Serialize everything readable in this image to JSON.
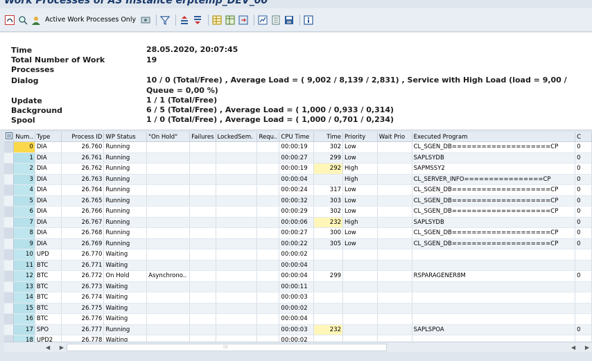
{
  "window": {
    "title": "Work Processes of AS Instance erptemp_DEV_00"
  },
  "toolbar": {
    "active_only_label": "Active Work Processes Only"
  },
  "info": [
    {
      "label": "Time",
      "value": "28.05.2020, 20:07:45"
    },
    {
      "label": "Total Number of Work Processes",
      "value": "19"
    },
    {
      "label": "Dialog",
      "value": "10 / 0 (Total/Free) , Average Load = ( 9,002 / 8,139 / 2,831) , Service with High Load (load = 9,00 / Queue = 0,00 %)"
    },
    {
      "label": "Update",
      "value": "1 / 1 (Total/Free)"
    },
    {
      "label": "Background",
      "value": "6 / 5 (Total/Free) , Average Load = ( 1,000 / 0,933 / 0,314)"
    },
    {
      "label": "Spool",
      "value": "1 / 0 (Total/Free) , Average Load = ( 1,000 / 0,701 / 0,234)"
    }
  ],
  "table": {
    "columns": [
      "Num..",
      "Type",
      "Process ID",
      "WP Status",
      "\"On Hold\"",
      "Failures",
      "LockedSem.",
      "Requ..",
      "CPU Time",
      "Time",
      "Priority",
      "Wait Prio",
      "Executed Program",
      "C"
    ],
    "rows": [
      [
        "0",
        "DIA",
        "26.760",
        "Running",
        "",
        "",
        "",
        "",
        "00:00:19",
        "302",
        "Low",
        "",
        "CL_SGEN_DB====================CP",
        "0"
      ],
      [
        "1",
        "DIA",
        "26.761",
        "Running",
        "",
        "",
        "",
        "",
        "00:00:27",
        "299",
        "Low",
        "",
        "SAPLSYDB",
        "0"
      ],
      [
        "2",
        "DIA",
        "26.762",
        "Running",
        "",
        "",
        "",
        "",
        "00:00:19",
        "292",
        "High",
        "",
        "SAPMSSY2",
        "0"
      ],
      [
        "3",
        "DIA",
        "26.763",
        "Running",
        "",
        "",
        "",
        "",
        "00:00:04",
        "",
        "High",
        "",
        "CL_SERVER_INFO================CP",
        "0"
      ],
      [
        "4",
        "DIA",
        "26.764",
        "Running",
        "",
        "",
        "",
        "",
        "00:00:24",
        "317",
        "Low",
        "",
        "CL_SGEN_DB====================CP",
        "0"
      ],
      [
        "5",
        "DIA",
        "26.765",
        "Running",
        "",
        "",
        "",
        "",
        "00:00:32",
        "303",
        "Low",
        "",
        "CL_SGEN_DB====================CP",
        "0"
      ],
      [
        "6",
        "DIA",
        "26.766",
        "Running",
        "",
        "",
        "",
        "",
        "00:00:29",
        "302",
        "Low",
        "",
        "CL_SGEN_DB====================CP",
        "0"
      ],
      [
        "7",
        "DIA",
        "26.767",
        "Running",
        "",
        "",
        "",
        "",
        "00:00:06",
        "232",
        "High",
        "",
        "SAPLSYDB",
        "0"
      ],
      [
        "8",
        "DIA",
        "26.768",
        "Running",
        "",
        "",
        "",
        "",
        "00:00:27",
        "300",
        "Low",
        "",
        "CL_SGEN_DB====================CP",
        "0"
      ],
      [
        "9",
        "DIA",
        "26.769",
        "Running",
        "",
        "",
        "",
        "",
        "00:00:22",
        "305",
        "Low",
        "",
        "CL_SGEN_DB====================CP",
        "0"
      ],
      [
        "10",
        "UPD",
        "26.770",
        "Waiting",
        "",
        "",
        "",
        "",
        "00:00:02",
        "",
        "",
        "",
        "",
        ""
      ],
      [
        "11",
        "BTC",
        "26.771",
        "Waiting",
        "",
        "",
        "",
        "",
        "00:00:04",
        "",
        "",
        "",
        "",
        ""
      ],
      [
        "12",
        "BTC",
        "26.772",
        "On Hold",
        "Asynchrono..",
        "",
        "",
        "",
        "00:00:04",
        "299",
        "",
        "",
        "RSPARAGENER8M",
        "0"
      ],
      [
        "13",
        "BTC",
        "26.773",
        "Waiting",
        "",
        "",
        "",
        "",
        "00:00:11",
        "",
        "",
        "",
        "",
        ""
      ],
      [
        "14",
        "BTC",
        "26.774",
        "Waiting",
        "",
        "",
        "",
        "",
        "00:00:03",
        "",
        "",
        "",
        "",
        ""
      ],
      [
        "15",
        "BTC",
        "26.775",
        "Waiting",
        "",
        "",
        "",
        "",
        "00:00:02",
        "",
        "",
        "",
        "",
        ""
      ],
      [
        "16",
        "BTC",
        "26.776",
        "Waiting",
        "",
        "",
        "",
        "",
        "00:00:04",
        "",
        "",
        "",
        "",
        ""
      ],
      [
        "17",
        "SPO",
        "26.777",
        "Running",
        "",
        "",
        "",
        "",
        "00:00:03",
        "232",
        "",
        "",
        "SAPLSPOA",
        "0"
      ],
      [
        "18",
        "UPD2",
        "26.778",
        "Waiting",
        "",
        "",
        "",
        "",
        "00:00:02",
        "",
        "",
        "",
        "",
        ""
      ]
    ],
    "highlight_time_rows": [
      2,
      7,
      17
    ]
  },
  "colors": {
    "accent": "#1a3a6a",
    "num_cell": "#bfe6ee",
    "current_cell": "#fbd84a",
    "time_highlight": "#fff6b8"
  }
}
